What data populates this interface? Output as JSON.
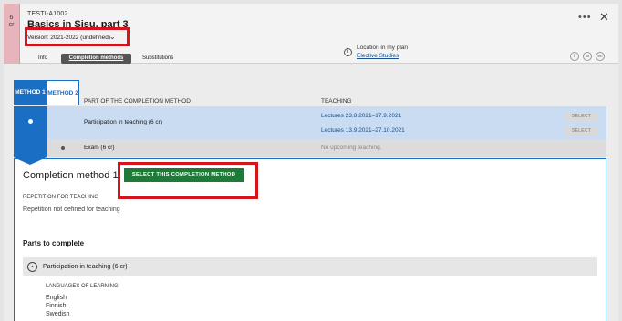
{
  "header": {
    "credits_number": "6",
    "credits_unit": "cr",
    "course_code": "TESTI-A1002",
    "course_title": "Basics in Sisu, part 3",
    "version": "Version: 2021-2022 (undefined)",
    "tabs": [
      {
        "label": "Info"
      },
      {
        "label": "Completion methods",
        "active": true
      },
      {
        "label": "Substitutions"
      }
    ],
    "location_label": "Location in my plan",
    "location_link": "Elective Studies",
    "languages": [
      "fi",
      "sv",
      "en"
    ]
  },
  "methods": {
    "tabs": [
      {
        "label": "METHOD 1",
        "active": true
      },
      {
        "label": "METHOD 2"
      }
    ],
    "col_part": "PART OF THE COMPLETION METHOD",
    "col_teaching": "TEACHING",
    "rows": [
      {
        "part": "Participation in teaching (6 cr)",
        "teaching": [
          "Lectures 23.8.2021–17.9.2021",
          "Lectures 13.9.2021–27.10.2021"
        ],
        "select_label": "SELECT"
      },
      {
        "part": "Exam (6 cr)",
        "teaching_empty": "No upcoming teaching."
      }
    ]
  },
  "panel": {
    "title": "Completion method 1",
    "select_button": "SELECT THIS COMPLETION METHOD",
    "repetition_label": "REPETITION FOR TEACHING",
    "repetition_text": "Repetition not defined for teaching",
    "parts_title": "Parts to complete",
    "part_item": "Participation in teaching (6 cr)",
    "languages_label": "LANGUAGES OF LEARNING",
    "languages": [
      "English",
      "Finnish",
      "Swedish"
    ]
  },
  "colors": {
    "primary_blue": "#1a6fc4",
    "highlight_red": "#d6141b",
    "select_green": "#1f7a3a",
    "credits_pink": "#e8b4bc"
  }
}
